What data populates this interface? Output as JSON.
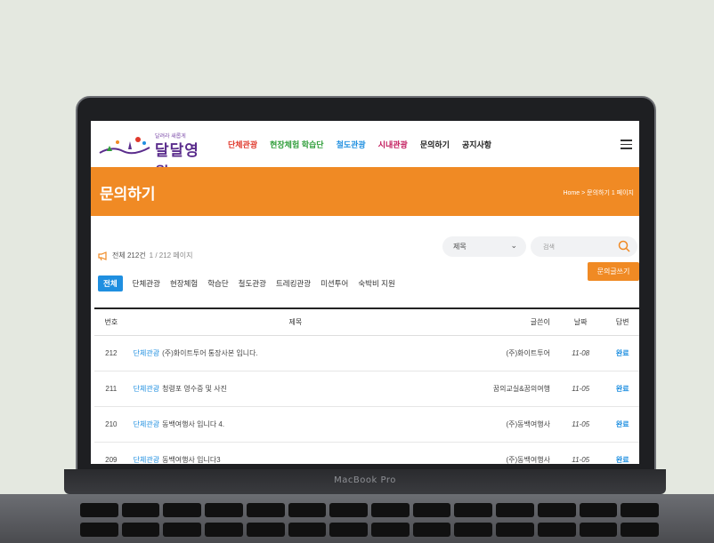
{
  "device": {
    "brand": "MacBook Pro"
  },
  "header": {
    "logo_tagline": "달려라 새롭게",
    "logo_text": "달달영월",
    "nav": [
      {
        "label": "단체관광",
        "color": "#e0392c"
      },
      {
        "label": "현장체험 학습단",
        "color": "#2f9e3a"
      },
      {
        "label": "철도관광",
        "color": "#1f8fe0"
      },
      {
        "label": "시내관광",
        "color": "#c2185b"
      },
      {
        "label": "문의하기",
        "color": "#222222"
      },
      {
        "label": "공지사항",
        "color": "#222222"
      }
    ]
  },
  "banner": {
    "title": "문의하기",
    "breadcrumb": "Home > 문의하기 1 페이지"
  },
  "toolbar": {
    "total": "전체 212건",
    "page_info": "1 / 212 페이지",
    "select_value": "제목",
    "search_placeholder": "검색",
    "write_label": "문의글쓰기"
  },
  "tabs": [
    "전체",
    "단체관광",
    "현장체험",
    "학습단",
    "철도관광",
    "트레킹관광",
    "미션투어",
    "숙박비 지원"
  ],
  "table": {
    "headers": {
      "no": "번호",
      "title": "제목",
      "author": "글쓴이",
      "date": "날짜",
      "answer": "답변"
    },
    "rows": [
      {
        "no": "212",
        "category": "단체관광",
        "title": "(주)화이트투어 통장사본 입니다.",
        "author": "(주)화이트투어",
        "date": "11-08",
        "answer": "완료"
      },
      {
        "no": "211",
        "category": "단체관광",
        "title": "청령포 영수증 및 사진",
        "author": "꿈의교실&꿈의여행",
        "date": "11-05",
        "answer": "완료"
      },
      {
        "no": "210",
        "category": "단체관광",
        "title": "동백여행사 입니다 4.",
        "author": "(주)동백여행사",
        "date": "11-05",
        "answer": "완료"
      },
      {
        "no": "209",
        "category": "단체관광",
        "title": "동백여행사 입니다3",
        "author": "(주)동백여행사",
        "date": "11-05",
        "answer": "완료"
      }
    ]
  },
  "colors": {
    "accent": "#f08a24",
    "link": "#1f8fe0"
  }
}
